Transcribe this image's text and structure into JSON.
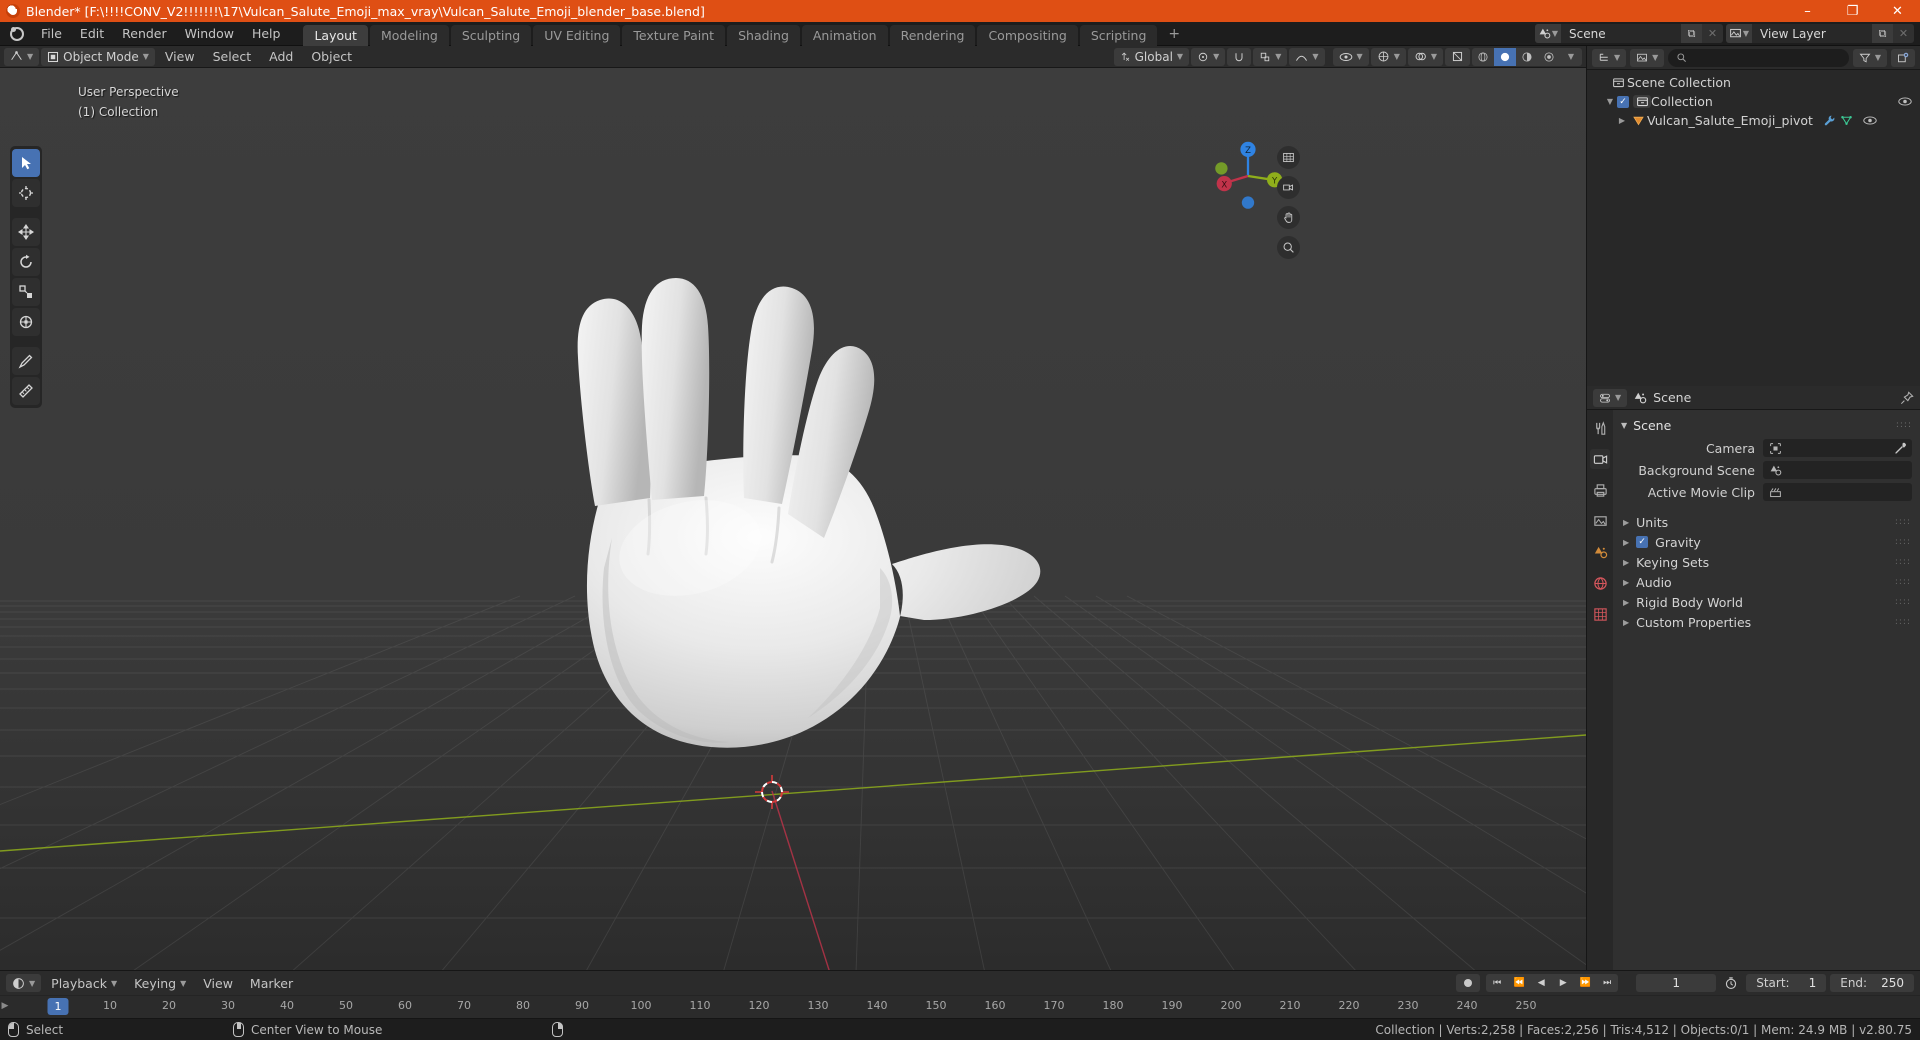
{
  "window": {
    "title": "Blender* [F:\\!!!!CONV_V2!!!!!!!\\17\\Vulcan_Salute_Emoji_max_vray\\Vulcan_Salute_Emoji_blender_base.blend]",
    "minimize": "–",
    "maximize": "❐",
    "close": "✕"
  },
  "topbar": {
    "menus": [
      "File",
      "Edit",
      "Render",
      "Window",
      "Help"
    ],
    "workspaces": [
      {
        "label": "Layout",
        "active": true
      },
      {
        "label": "Modeling",
        "active": false
      },
      {
        "label": "Sculpting",
        "active": false
      },
      {
        "label": "UV Editing",
        "active": false
      },
      {
        "label": "Texture Paint",
        "active": false
      },
      {
        "label": "Shading",
        "active": false
      },
      {
        "label": "Animation",
        "active": false
      },
      {
        "label": "Rendering",
        "active": false
      },
      {
        "label": "Compositing",
        "active": false
      },
      {
        "label": "Scripting",
        "active": false
      }
    ],
    "add_workspace": "+",
    "scene": {
      "name": "Scene",
      "new_btn": "⧉",
      "unlink_btn": "✕"
    },
    "view_layer": {
      "name": "View Layer",
      "new_btn": "⧉",
      "unlink_btn": "✕"
    }
  },
  "viewport": {
    "mode": "Object Mode",
    "menus": [
      "View",
      "Select",
      "Add",
      "Object"
    ],
    "transform_orientation": "Global",
    "overlay_line1": "User Perspective",
    "overlay_line2": "(1) Collection",
    "gizmo_axes": {
      "z": "Z",
      "x": "X",
      "y": "Y"
    },
    "tools": [
      {
        "name": "tweak-tool",
        "active": true
      },
      {
        "name": "cursor-tool",
        "active": false
      },
      {
        "name": "move-tool",
        "active": false
      },
      {
        "name": "rotate-tool",
        "active": false
      },
      {
        "name": "scale-tool",
        "active": false
      },
      {
        "name": "transform-tool",
        "active": false
      },
      {
        "name": "annotate-tool",
        "active": false
      },
      {
        "name": "measure-tool",
        "active": false
      }
    ]
  },
  "outliner": {
    "search_placeholder": "",
    "rows": [
      {
        "label": "Scene Collection",
        "indent": 0,
        "type": "scene-collection",
        "disclose": "",
        "checkbox": false,
        "eye": false,
        "selected": false
      },
      {
        "label": "Collection",
        "indent": 1,
        "type": "collection",
        "disclose": "▼",
        "checkbox": true,
        "eye": true,
        "selected": false
      },
      {
        "label": "Vulcan_Salute_Emoji_pivot",
        "indent": 2,
        "type": "mesh-object",
        "disclose": "▶",
        "checkbox": false,
        "eye": true,
        "selected": false
      }
    ]
  },
  "properties": {
    "breadcrumb": "Scene",
    "panel_title": "Scene",
    "rows": [
      {
        "label": "Camera",
        "value": "",
        "icon": "camera-icon",
        "eyedropper": true
      },
      {
        "label": "Background Scene",
        "value": "",
        "icon": "scene-icon",
        "eyedropper": false
      },
      {
        "label": "Active Movie Clip",
        "value": "",
        "icon": "clip-icon",
        "eyedropper": false
      }
    ],
    "sub_panels": [
      {
        "label": "Units",
        "checkbox": false
      },
      {
        "label": "Gravity",
        "checkbox": true
      },
      {
        "label": "Keying Sets",
        "checkbox": false
      },
      {
        "label": "Audio",
        "checkbox": false
      },
      {
        "label": "Rigid Body World",
        "checkbox": false
      },
      {
        "label": "Custom Properties",
        "checkbox": false
      }
    ]
  },
  "timeline": {
    "menus": [
      "Playback",
      "Keying",
      "View",
      "Marker"
    ],
    "current_frame": "1",
    "start_label": "Start:",
    "start_value": "1",
    "end_label": "End:",
    "end_value": "250",
    "ticks": [
      "10",
      "20",
      "30",
      "40",
      "50",
      "60",
      "70",
      "80",
      "90",
      "100",
      "110",
      "120",
      "130",
      "140",
      "150",
      "160",
      "170",
      "180",
      "190",
      "200",
      "210",
      "220",
      "230",
      "240",
      "250"
    ],
    "playhead_label": "1"
  },
  "statusbar": {
    "left_items": [
      {
        "label": "Select",
        "mouse": "left"
      },
      {
        "label": "Center View to Mouse",
        "mouse": "middle"
      },
      {
        "label": "",
        "mouse": "right"
      }
    ],
    "stats": "Collection | Verts:2,258 | Faces:2,256 | Tris:4,512 | Objects:0/1 | Mem: 24.9 MB | v2.80.75"
  },
  "colors": {
    "accent_orange": "#df4f14",
    "accent_blue": "#4772b3",
    "axis_x": "#c1334a",
    "axis_y": "#8fae1b",
    "axis_z": "#2f83e3"
  }
}
